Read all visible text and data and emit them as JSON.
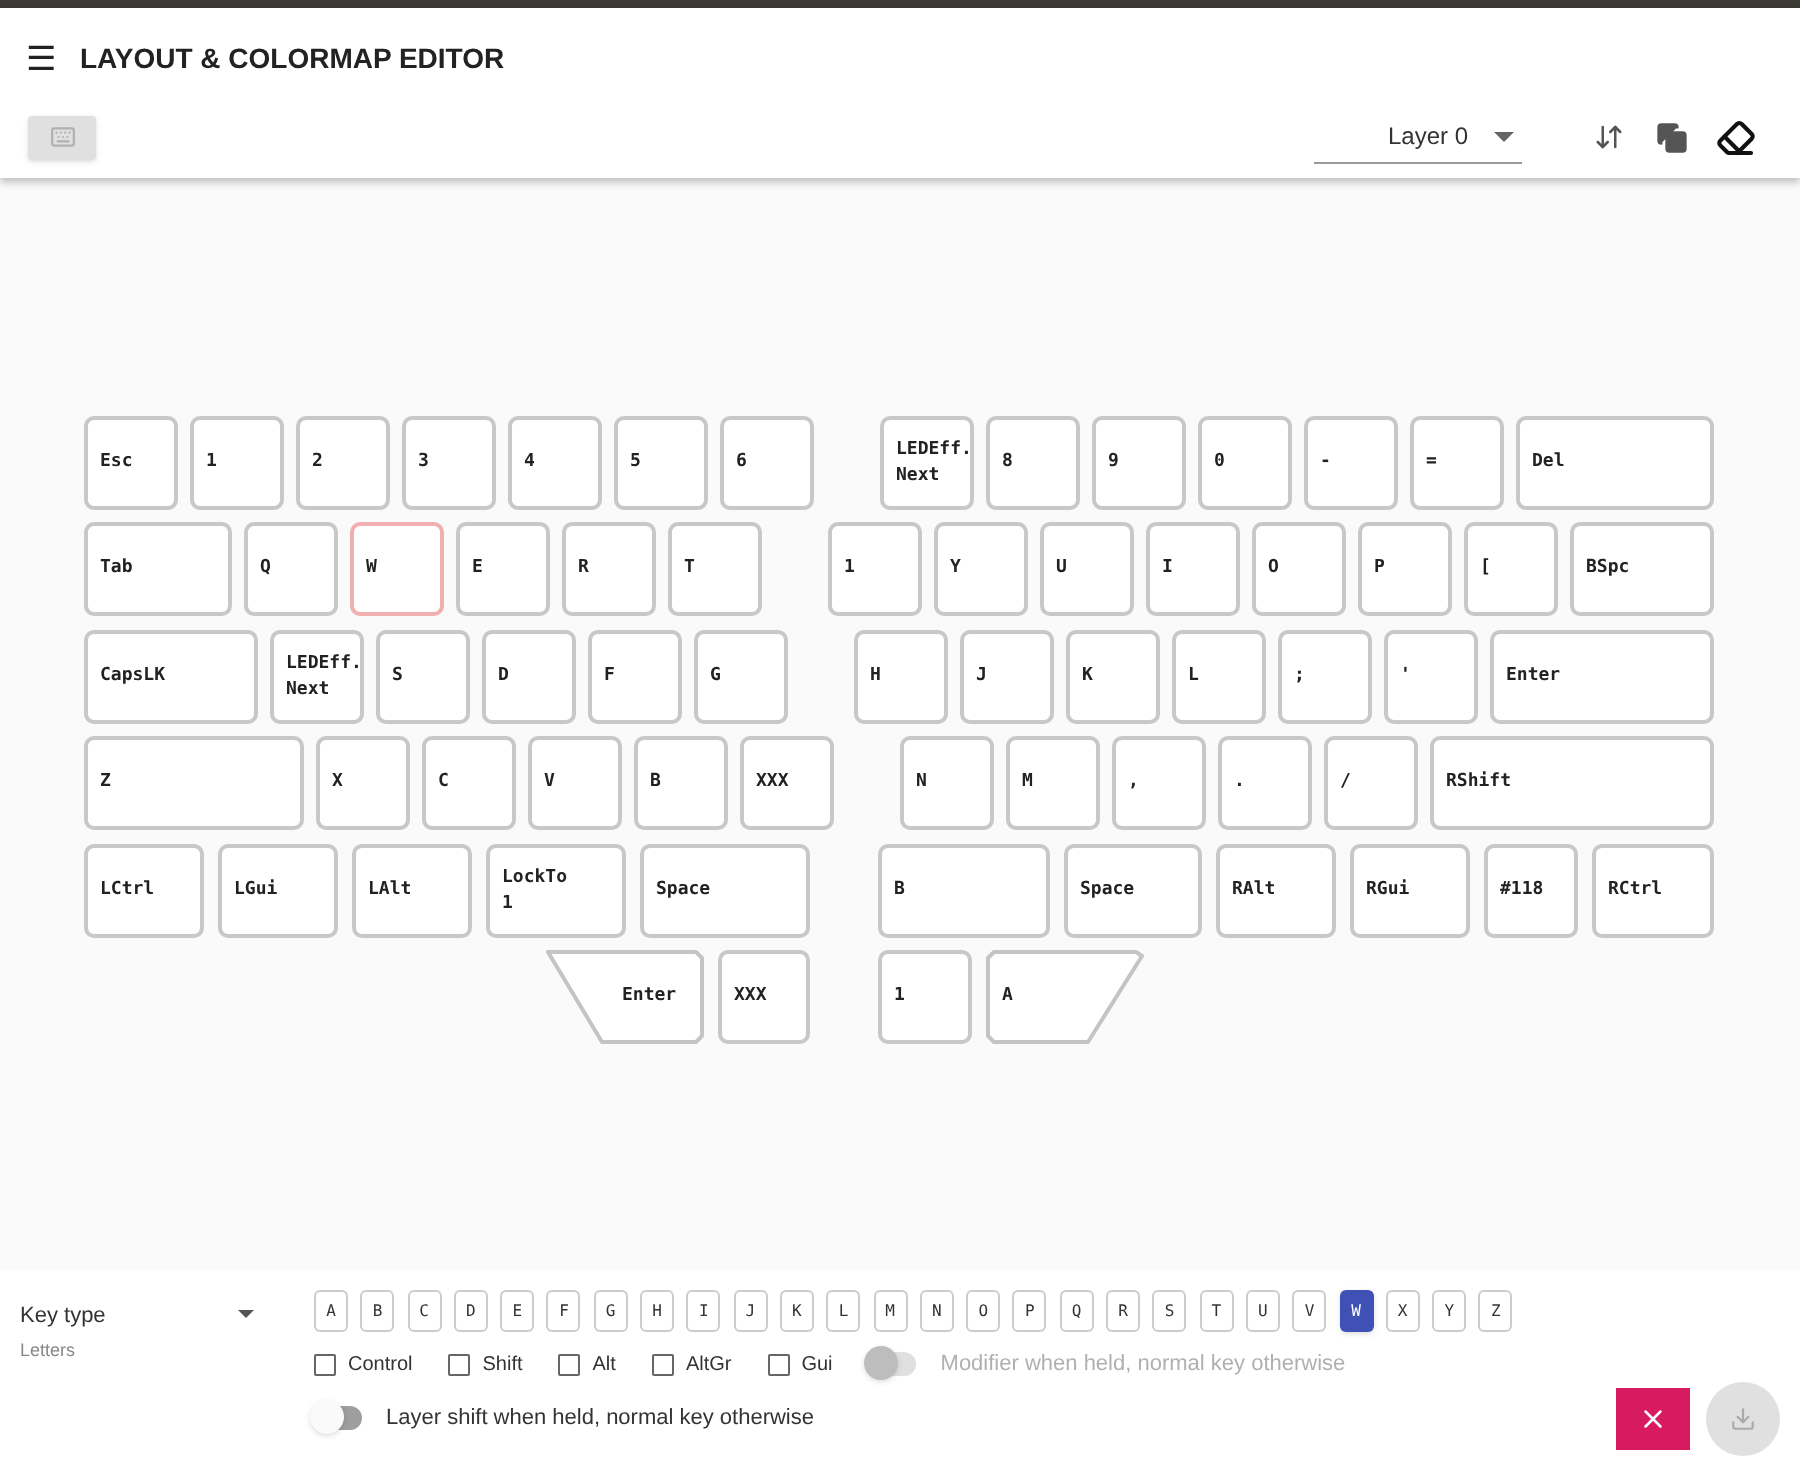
{
  "app_bar": {
    "menu_icon": "☰",
    "title": "LAYOUT & COLORMAP EDITOR"
  },
  "toolbar": {
    "layer_select": {
      "value": "Layer 0"
    }
  },
  "keyboard": {
    "keys": [
      {
        "legend": [
          "Esc"
        ],
        "selected": false,
        "kind": "key"
      },
      {
        "legend": [
          "1"
        ],
        "selected": false,
        "kind": "key"
      },
      {
        "legend": [
          "2"
        ],
        "selected": false,
        "kind": "key"
      },
      {
        "legend": [
          "3"
        ],
        "selected": false,
        "kind": "key"
      },
      {
        "legend": [
          "4"
        ],
        "selected": false,
        "kind": "key"
      },
      {
        "legend": [
          "5"
        ],
        "selected": false,
        "kind": "key"
      },
      {
        "legend": [
          "6"
        ],
        "selected": false,
        "kind": "key"
      },
      {
        "legend": [
          "LEDEff.",
          "Next"
        ],
        "selected": false,
        "kind": "key"
      },
      {
        "legend": [
          "8"
        ],
        "selected": false,
        "kind": "key"
      },
      {
        "legend": [
          "9"
        ],
        "selected": false,
        "kind": "key"
      },
      {
        "legend": [
          "0"
        ],
        "selected": false,
        "kind": "key"
      },
      {
        "legend": [
          "-"
        ],
        "selected": false,
        "kind": "key"
      },
      {
        "legend": [
          "="
        ],
        "selected": false,
        "kind": "key"
      },
      {
        "legend": [
          "Del"
        ],
        "selected": false,
        "kind": "key"
      },
      {
        "legend": [
          "Tab"
        ],
        "selected": false,
        "kind": "key"
      },
      {
        "legend": [
          "Q"
        ],
        "selected": false,
        "kind": "key"
      },
      {
        "legend": [
          "W"
        ],
        "selected": true,
        "kind": "key"
      },
      {
        "legend": [
          "E"
        ],
        "selected": false,
        "kind": "key"
      },
      {
        "legend": [
          "R"
        ],
        "selected": false,
        "kind": "key"
      },
      {
        "legend": [
          "T"
        ],
        "selected": false,
        "kind": "key"
      },
      {
        "legend": [
          "1"
        ],
        "selected": false,
        "kind": "key"
      },
      {
        "legend": [
          "Y"
        ],
        "selected": false,
        "kind": "key"
      },
      {
        "legend": [
          "U"
        ],
        "selected": false,
        "kind": "key"
      },
      {
        "legend": [
          "I"
        ],
        "selected": false,
        "kind": "key"
      },
      {
        "legend": [
          "O"
        ],
        "selected": false,
        "kind": "key"
      },
      {
        "legend": [
          "P"
        ],
        "selected": false,
        "kind": "key"
      },
      {
        "legend": [
          "["
        ],
        "selected": false,
        "kind": "key"
      },
      {
        "legend": [
          "BSpc"
        ],
        "selected": false,
        "kind": "key"
      },
      {
        "legend": [
          "CapsLK"
        ],
        "selected": false,
        "kind": "key"
      },
      {
        "legend": [
          "LEDEff.",
          "Next"
        ],
        "selected": false,
        "kind": "key"
      },
      {
        "legend": [
          "S"
        ],
        "selected": false,
        "kind": "key"
      },
      {
        "legend": [
          "D"
        ],
        "selected": false,
        "kind": "key"
      },
      {
        "legend": [
          "F"
        ],
        "selected": false,
        "kind": "key"
      },
      {
        "legend": [
          "G"
        ],
        "selected": false,
        "kind": "key"
      },
      {
        "legend": [
          "H"
        ],
        "selected": false,
        "kind": "key"
      },
      {
        "legend": [
          "J"
        ],
        "selected": false,
        "kind": "key"
      },
      {
        "legend": [
          "K"
        ],
        "selected": false,
        "kind": "key"
      },
      {
        "legend": [
          "L"
        ],
        "selected": false,
        "kind": "key"
      },
      {
        "legend": [
          ";"
        ],
        "selected": false,
        "kind": "key"
      },
      {
        "legend": [
          "'"
        ],
        "selected": false,
        "kind": "key"
      },
      {
        "legend": [
          "Enter"
        ],
        "selected": false,
        "kind": "key"
      },
      {
        "legend": [
          "Z"
        ],
        "selected": false,
        "kind": "key"
      },
      {
        "legend": [
          "X"
        ],
        "selected": false,
        "kind": "key"
      },
      {
        "legend": [
          "C"
        ],
        "selected": false,
        "kind": "key"
      },
      {
        "legend": [
          "V"
        ],
        "selected": false,
        "kind": "key"
      },
      {
        "legend": [
          "B"
        ],
        "selected": false,
        "kind": "key"
      },
      {
        "legend": [
          "XXX"
        ],
        "selected": false,
        "kind": "key"
      },
      {
        "legend": [
          "N"
        ],
        "selected": false,
        "kind": "key"
      },
      {
        "legend": [
          "M"
        ],
        "selected": false,
        "kind": "key"
      },
      {
        "legend": [
          ","
        ],
        "selected": false,
        "kind": "key"
      },
      {
        "legend": [
          "."
        ],
        "selected": false,
        "kind": "key"
      },
      {
        "legend": [
          "/"
        ],
        "selected": false,
        "kind": "key"
      },
      {
        "legend": [
          "RShift"
        ],
        "selected": false,
        "kind": "key"
      },
      {
        "legend": [
          "LCtrl"
        ],
        "selected": false,
        "kind": "key"
      },
      {
        "legend": [
          "LGui"
        ],
        "selected": false,
        "kind": "key"
      },
      {
        "legend": [
          "LAlt"
        ],
        "selected": false,
        "kind": "key"
      },
      {
        "legend": [
          "LockTo",
          "1"
        ],
        "selected": false,
        "kind": "key"
      },
      {
        "legend": [
          "Space"
        ],
        "selected": false,
        "kind": "key"
      },
      {
        "legend": [
          "B"
        ],
        "selected": false,
        "kind": "key"
      },
      {
        "legend": [
          "Space"
        ],
        "selected": false,
        "kind": "key"
      },
      {
        "legend": [
          "RAlt"
        ],
        "selected": false,
        "kind": "key"
      },
      {
        "legend": [
          "RGui"
        ],
        "selected": false,
        "kind": "key"
      },
      {
        "legend": [
          "#118"
        ],
        "selected": false,
        "kind": "key"
      },
      {
        "legend": [
          "RCtrl"
        ],
        "selected": false,
        "kind": "key"
      },
      {
        "legend": [
          "Enter"
        ],
        "selected": false,
        "kind": "thumb-left"
      },
      {
        "legend": [
          "XXX"
        ],
        "selected": false,
        "kind": "key"
      },
      {
        "legend": [
          "1"
        ],
        "selected": false,
        "kind": "key"
      },
      {
        "legend": [
          "A"
        ],
        "selected": false,
        "kind": "thumb-right"
      }
    ]
  },
  "editor": {
    "key_type": {
      "label": "Key type",
      "value": "Letters"
    },
    "letters": [
      {
        "label": "A",
        "selected": false
      },
      {
        "label": "B",
        "selected": false
      },
      {
        "label": "C",
        "selected": false
      },
      {
        "label": "D",
        "selected": false
      },
      {
        "label": "E",
        "selected": false
      },
      {
        "label": "F",
        "selected": false
      },
      {
        "label": "G",
        "selected": false
      },
      {
        "label": "H",
        "selected": false
      },
      {
        "label": "I",
        "selected": false
      },
      {
        "label": "J",
        "selected": false
      },
      {
        "label": "K",
        "selected": false
      },
      {
        "label": "L",
        "selected": false
      },
      {
        "label": "M",
        "selected": false
      },
      {
        "label": "N",
        "selected": false
      },
      {
        "label": "O",
        "selected": false
      },
      {
        "label": "P",
        "selected": false
      },
      {
        "label": "Q",
        "selected": false
      },
      {
        "label": "R",
        "selected": false
      },
      {
        "label": "S",
        "selected": false
      },
      {
        "label": "T",
        "selected": false
      },
      {
        "label": "U",
        "selected": false
      },
      {
        "label": "V",
        "selected": false
      },
      {
        "label": "W",
        "selected": true
      },
      {
        "label": "X",
        "selected": false
      },
      {
        "label": "Y",
        "selected": false
      },
      {
        "label": "Z",
        "selected": false
      }
    ],
    "modifiers": [
      {
        "label": "Control",
        "checked": false
      },
      {
        "label": "Shift",
        "checked": false
      },
      {
        "label": "Alt",
        "checked": false
      },
      {
        "label": "AltGr",
        "checked": false
      },
      {
        "label": "Gui",
        "checked": false
      }
    ],
    "dual_use_toggle": {
      "label": "Modifier when held, normal key otherwise",
      "on": false,
      "disabled": true
    },
    "layer_toggle": {
      "label": "Layer shift when held, normal key otherwise",
      "on": false,
      "disabled": false
    }
  }
}
